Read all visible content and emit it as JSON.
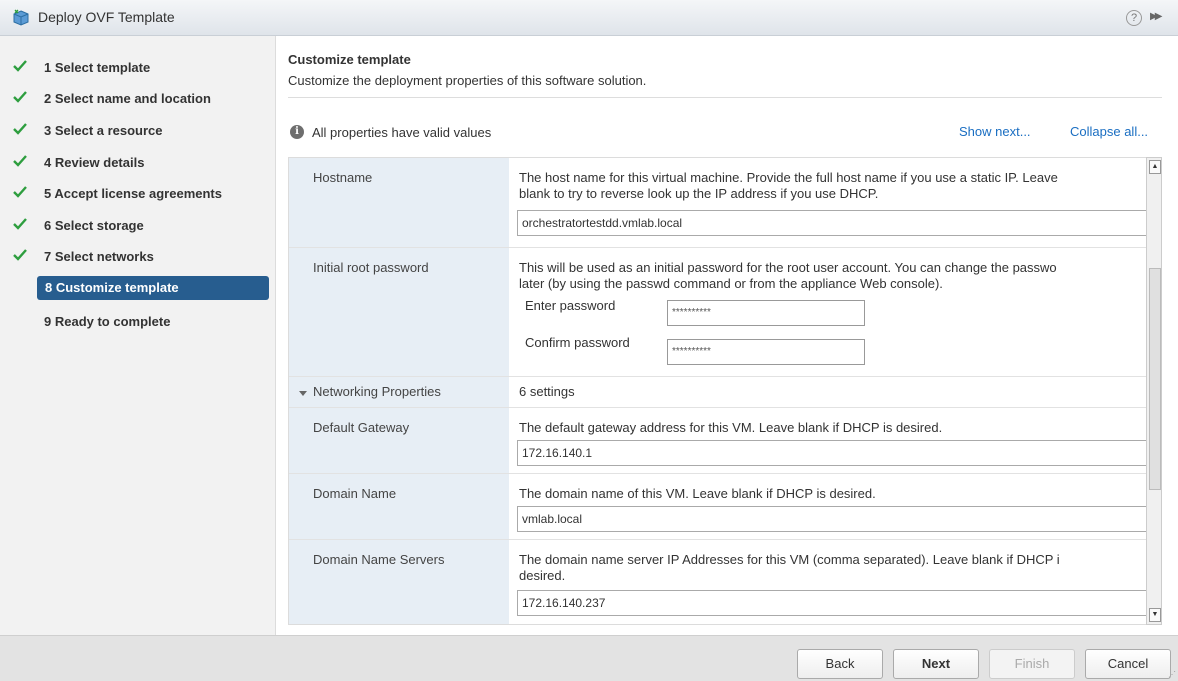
{
  "window": {
    "title": "Deploy OVF Template"
  },
  "steps": [
    {
      "label": "1  Select template",
      "done": true
    },
    {
      "label": "2  Select name and location",
      "done": true
    },
    {
      "label": "3  Select a resource",
      "done": true
    },
    {
      "label": "4  Review details",
      "done": true
    },
    {
      "label": "5  Accept license agreements",
      "done": true
    },
    {
      "label": "6  Select storage",
      "done": true
    },
    {
      "label": "7  Select networks",
      "done": true
    },
    {
      "label": "8  Customize template",
      "done": false,
      "active": true
    },
    {
      "label": "9  Ready to complete",
      "done": false
    }
  ],
  "main": {
    "heading": "Customize template",
    "subheading": "Customize the deployment properties of this software solution.",
    "status": "All properties have valid values",
    "show_next": "Show next...",
    "collapse_all": "Collapse all..."
  },
  "properties": {
    "hostname": {
      "name": "Hostname",
      "desc1": "The host name for this virtual machine. Provide the full host name if you use a static IP. Leave",
      "desc2": "blank to try to reverse look up the IP address if you use DHCP.",
      "value": "orchestratortestdd.vmlab.local"
    },
    "root_password": {
      "name": "Initial root password",
      "desc1": "This will be used as an initial password for the root user account. You can change the passwo",
      "desc2": "later (by using the passwd command or from the appliance Web console).",
      "enter_label": "Enter password",
      "enter_value": "**********",
      "confirm_label": "Confirm password",
      "confirm_value": "**********"
    },
    "networking": {
      "name": "Networking Properties",
      "summary": "6 settings"
    },
    "gateway": {
      "name": "Default Gateway",
      "desc1": "The default gateway address for this VM. Leave blank if DHCP is desired.",
      "value": "172.16.140.1"
    },
    "domain": {
      "name": "Domain Name",
      "desc1": "The domain name of this VM. Leave blank if DHCP is desired.",
      "value": "vmlab.local"
    },
    "dns": {
      "name": "Domain Name Servers",
      "desc1": "The domain name server IP Addresses for this VM (comma separated). Leave blank if DHCP i",
      "desc2": "desired.",
      "value": "172.16.140.237"
    }
  },
  "footer": {
    "back": "Back",
    "next": "Next",
    "finish": "Finish",
    "cancel": "Cancel"
  },
  "colors": {
    "accent": "#275d8f",
    "check": "#2e9e3f",
    "link": "#1a6ec2",
    "label_col": "#e7eef5"
  }
}
